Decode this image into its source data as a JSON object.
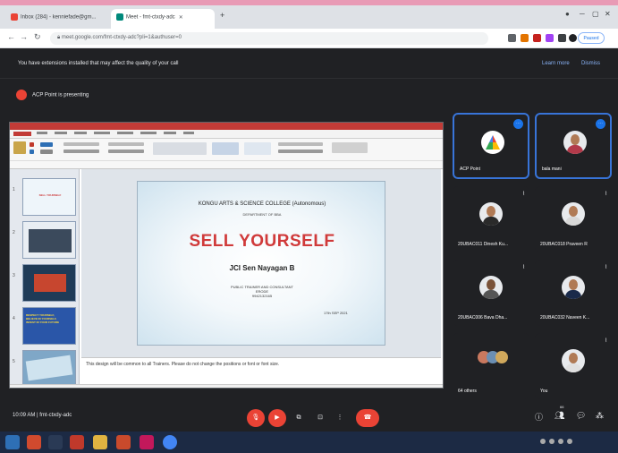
{
  "browser": {
    "tabs": [
      {
        "title": "Inbox (284) - kenniefade@gm..."
      },
      {
        "title": "Meet - fmt-ctxdy-adc"
      }
    ],
    "new_tab_symbol": "+",
    "url": "meet.google.com/fmt-ctxdy-adc?pli=1&authuser=0",
    "paused_label": "Paused"
  },
  "banner": {
    "message": "You have extensions installed that may affect the quality of your call",
    "learn_more": "Learn more",
    "dismiss": "Dismiss"
  },
  "presenting": {
    "text": "ACP Point is presenting"
  },
  "slide": {
    "college": "KONGU ARTS & SCIENCE COLLEGE (Autonomous)",
    "department": "DEPARTMENT OF BBA",
    "title": "SELL YOURSELF",
    "speaker": "JCI Sen Nayagan B",
    "role_line1": "PUBLIC TRAINER AND CONSULTANT",
    "role_line2": "ERODE",
    "role_line3": "9942132165",
    "date": "17th SEP 2021",
    "notes": "This design will be common to all Trainers. Please do not change the positions or font or font size.",
    "thumb_texts": [
      "SELL YOURSELF",
      "",
      "",
      "RESPECT YOURSELF, BELIEVE IN YOURSELF, INVEST IN YOUR FUTURE",
      ""
    ]
  },
  "participants": [
    {
      "name": "ACP Point"
    },
    {
      "name": "bala mani"
    },
    {
      "name": "20UBAC011 Dinesh Ku..."
    },
    {
      "name": "20UBAC018 Praveen R"
    },
    {
      "name": "20UBAC006 Bava Dha..."
    },
    {
      "name": "20UBAC032 Naveen K..."
    },
    {
      "name": "64 others"
    },
    {
      "name": "You"
    }
  ],
  "bottom_bar": {
    "time": "10:09 AM",
    "meeting_code": "fmt-ctxdy-adc",
    "people_count": "66"
  },
  "colors": {
    "accent": "#1a73e8",
    "end_call": "#ea4335",
    "slide_title": "#d03a3a",
    "meet_bg": "#202124"
  }
}
